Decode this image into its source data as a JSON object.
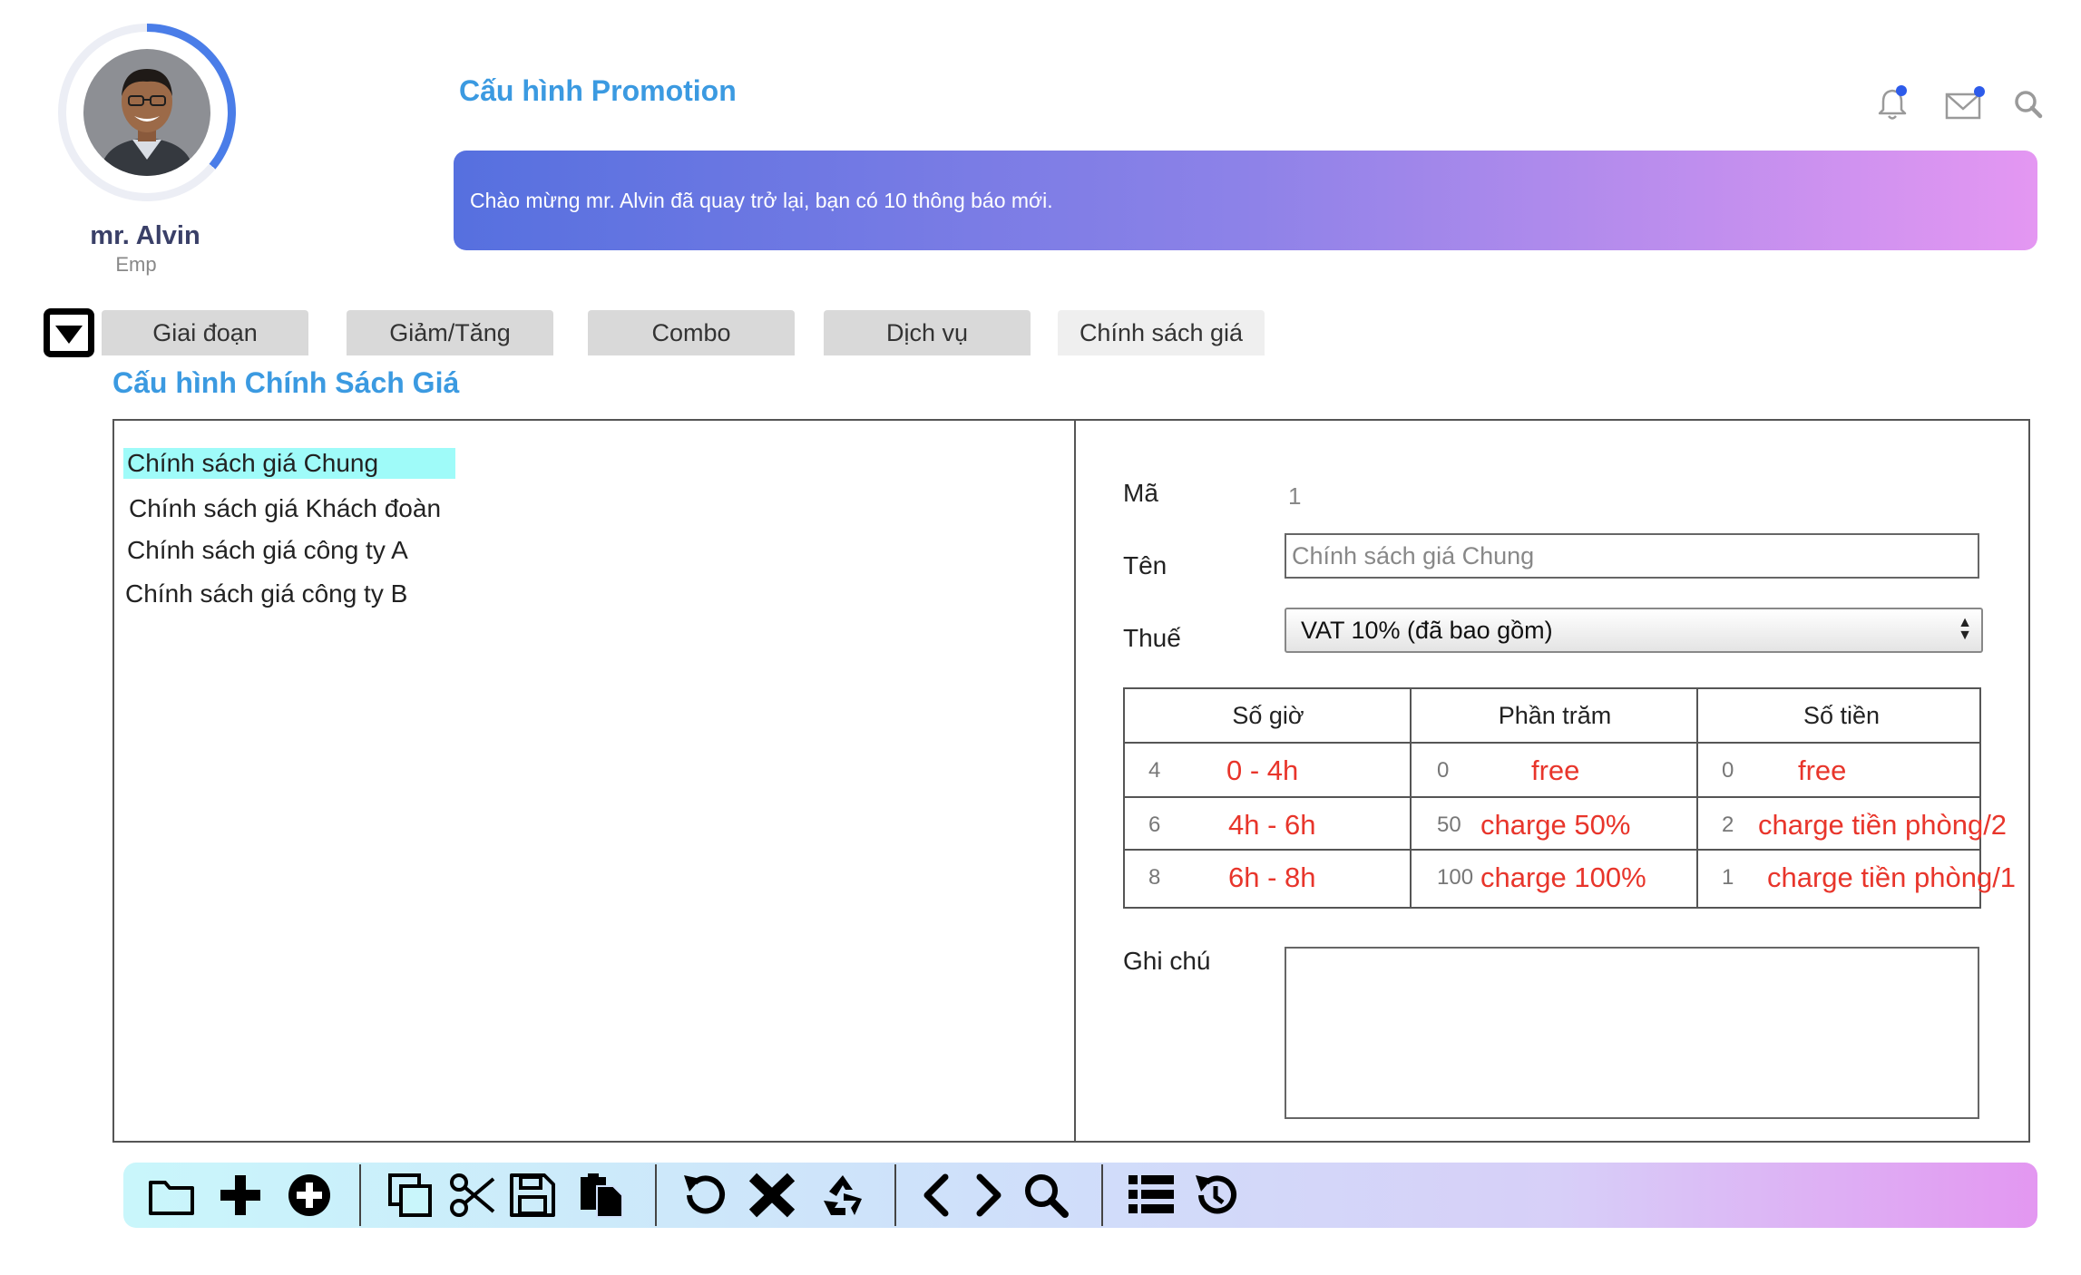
{
  "user": {
    "name": "mr. Alvin",
    "role": "Emp"
  },
  "header": {
    "title": "Cấu hình Promotion",
    "icons": [
      "bell-icon",
      "mail-icon",
      "search-icon"
    ],
    "banner": "Chào mừng mr. Alvin đã quay trở lại, bạn có 10 thông báo mới."
  },
  "tabs": [
    {
      "label": "Giai đoạn",
      "active": false
    },
    {
      "label": "Giảm/Tăng",
      "active": false
    },
    {
      "label": "Combo",
      "active": false
    },
    {
      "label": "Dịch vụ",
      "active": false
    },
    {
      "label": "Chính sách giá",
      "active": true
    }
  ],
  "section_title": "Cấu hình Chính Sách Giá",
  "policy_list": {
    "items": [
      "Chính sách giá Chung",
      "Chính sách giá Khách đoàn",
      "Chính sách giá công ty A",
      "Chính sách giá công ty B"
    ],
    "selected": "Chính sách giá Chung"
  },
  "form": {
    "code_label": "Mã",
    "code_value": "1",
    "name_label": "Tên",
    "name_value": "Chính sách giá Chung",
    "tax_label": "Thuế",
    "tax_value": "VAT 10% (đã bao gồm)",
    "note_label": "Ghi chú",
    "note_value": ""
  },
  "grid": {
    "headers": [
      "Số giờ",
      "Phần trăm",
      "Số tiền"
    ],
    "rows": [
      {
        "hours": "4",
        "hours_note": "0 - 4h",
        "percent": "0",
        "percent_note": "free",
        "amount": "0",
        "amount_note": "free"
      },
      {
        "hours": "6",
        "hours_note": "4h - 6h",
        "percent": "50",
        "percent_note": "charge 50%",
        "amount": "2",
        "amount_note": "charge tiền phòng/2"
      },
      {
        "hours": "8",
        "hours_note": "6h - 8h",
        "percent": "100",
        "percent_note": "charge 100%",
        "amount": "1",
        "amount_note": "charge tiền phòng/1"
      }
    ]
  },
  "toolbar": {
    "groups": [
      [
        "folder-icon",
        "plus-icon",
        "add-circle-icon"
      ],
      [
        "copy-icon",
        "cut-icon",
        "save-icon",
        "paste-icon"
      ],
      [
        "undo-icon",
        "delete-icon",
        "recycle-icon"
      ],
      [
        "previous-icon",
        "next-icon",
        "search-icon"
      ],
      [
        "list-icon",
        "history-icon"
      ]
    ]
  },
  "colors": {
    "accent": "#3b9ae1",
    "notification_dot": "#2d5bea",
    "highlight": "#9ffbf9",
    "note_red": "#e8352b"
  }
}
